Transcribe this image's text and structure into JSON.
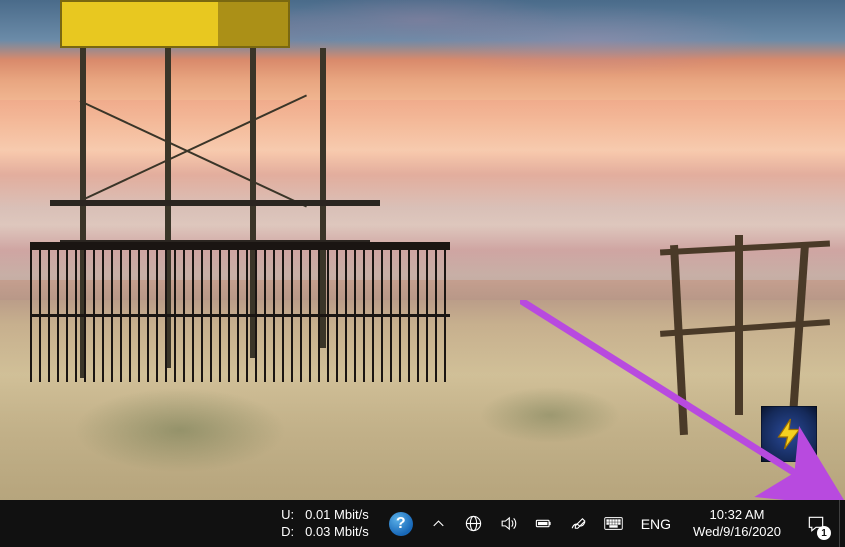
{
  "netmon": {
    "up_label": "U:",
    "up_value": "0.01 Mbit/s",
    "down_label": "D:",
    "down_value": "0.03 Mbit/s"
  },
  "tray": {
    "help_symbol": "?",
    "language": "ENG"
  },
  "clock": {
    "time": "10:32 AM",
    "date": "Wed/9/16/2020"
  },
  "action_center": {
    "badge_count": "1"
  },
  "icons": {
    "help": "help-icon",
    "chevron_up": "chevron-up-icon",
    "network": "network-icon",
    "volume": "volume-icon",
    "battery": "battery-icon",
    "pen": "pen-workspace-icon",
    "keyboard": "touch-keyboard-icon",
    "action_center": "action-center-icon",
    "desktop_app": "lightning-icon"
  },
  "colors": {
    "taskbar_bg": "#111111",
    "arrow": "#b84adf",
    "tower_yellow": "#e8c820",
    "help_blue": "#1868b8"
  }
}
